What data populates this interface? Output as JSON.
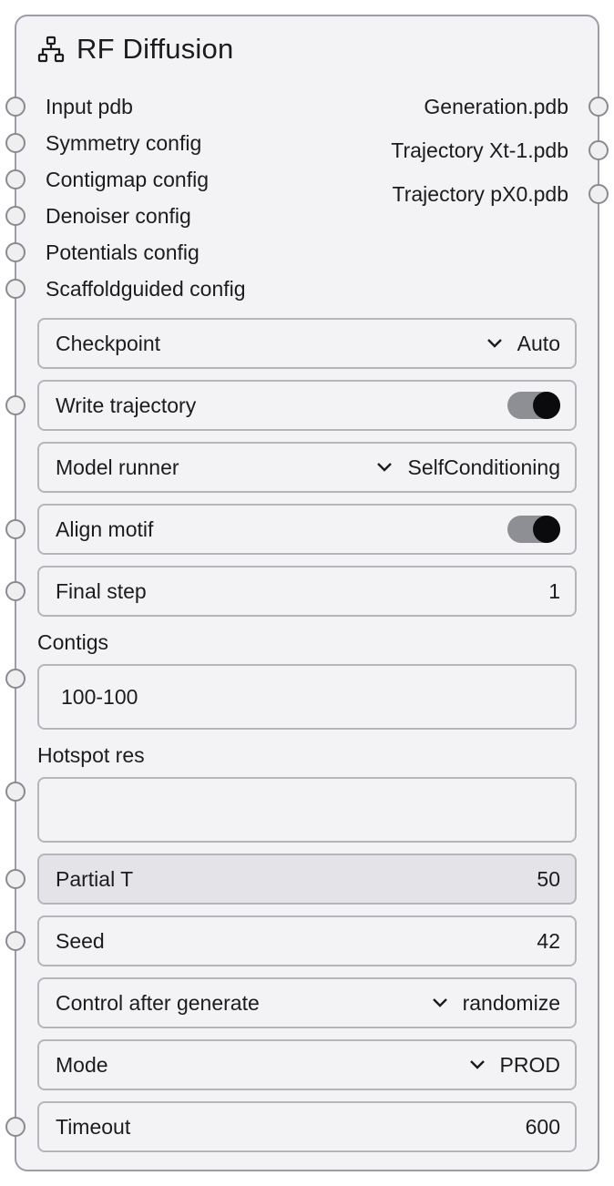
{
  "node": {
    "title": "RF Diffusion",
    "title_icon": "hierarchy-icon",
    "inputs": [
      "Input pdb",
      "Symmetry config",
      "Contigmap config",
      "Denoiser config",
      "Potentials config",
      "Scaffoldguided config"
    ],
    "outputs": [
      "Generation.pdb",
      "Trajectory Xt-1.pdb",
      "Trajectory pX0.pdb"
    ]
  },
  "widgets": {
    "checkpoint": {
      "label": "Checkpoint",
      "value": "Auto"
    },
    "write_trajectory": {
      "label": "Write trajectory",
      "on": true
    },
    "model_runner": {
      "label": "Model runner",
      "value": "SelfConditioning"
    },
    "align_motif": {
      "label": "Align motif",
      "on": true
    },
    "final_step": {
      "label": "Final step",
      "value": "1"
    },
    "contigs": {
      "label": "Contigs",
      "value": "100-100"
    },
    "hotspot_res": {
      "label": "Hotspot res",
      "value": ""
    },
    "partial_t": {
      "label": "Partial T",
      "value": "50"
    },
    "seed": {
      "label": "Seed",
      "value": "42"
    },
    "control_after_generate": {
      "label": "Control after generate",
      "value": "randomize"
    },
    "mode": {
      "label": "Mode",
      "value": "PROD"
    },
    "timeout": {
      "label": "Timeout",
      "value": "600"
    }
  },
  "colors": {
    "toggle_track": "#8e8e95",
    "toggle_knob": "#0b0b0d",
    "node_bg": "#f3f3f6",
    "border": "#9d9da6"
  }
}
